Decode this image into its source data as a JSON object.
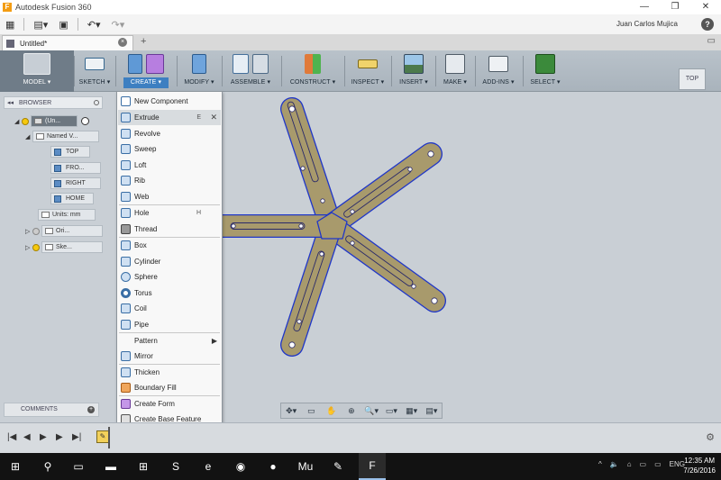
{
  "window": {
    "app_title": "Autodesk Fusion 360",
    "logo_letter": "F",
    "min_icon": "—",
    "close_icon": "✕",
    "restore_icon": "❐"
  },
  "quick_access": {
    "user": "Juan Carlos Mujica",
    "help": "?"
  },
  "document_tab": {
    "title": "Untitled*",
    "close": "×"
  },
  "ribbon": {
    "groups": [
      {
        "label": "MODEL ▾"
      },
      {
        "label": "SKETCH ▾"
      },
      {
        "label": "CREATE ▾"
      },
      {
        "label": "MODIFY ▾"
      },
      {
        "label": "ASSEMBLE ▾"
      },
      {
        "label": "CONSTRUCT ▾"
      },
      {
        "label": "INSPECT ▾"
      },
      {
        "label": "INSERT ▾"
      },
      {
        "label": "MAKE ▾"
      },
      {
        "label": "ADD-INS ▾"
      },
      {
        "label": "SELECT ▾"
      }
    ]
  },
  "viewcube": {
    "label": "TOP"
  },
  "browser": {
    "title": "BROWSER",
    "root": "(Un...",
    "named_views": "Named V...",
    "views": [
      "TOP",
      "FRO...",
      "RIGHT",
      "HOME"
    ],
    "units": "Units: mm",
    "origin": "Ori...",
    "sketches": "Ske..."
  },
  "comments": {
    "title": "COMMENTS",
    "plus": "+"
  },
  "create_menu": {
    "items": [
      {
        "label": "New Component",
        "shortcut": ""
      },
      {
        "label": "Extrude",
        "shortcut": "E"
      },
      {
        "label": "Revolve",
        "shortcut": ""
      },
      {
        "label": "Sweep",
        "shortcut": ""
      },
      {
        "label": "Loft",
        "shortcut": ""
      },
      {
        "label": "Rib",
        "shortcut": ""
      },
      {
        "label": "Web",
        "shortcut": ""
      },
      {
        "label": "Hole",
        "shortcut": "H"
      },
      {
        "label": "Thread",
        "shortcut": ""
      },
      {
        "label": "Box",
        "shortcut": ""
      },
      {
        "label": "Cylinder",
        "shortcut": ""
      },
      {
        "label": "Sphere",
        "shortcut": ""
      },
      {
        "label": "Torus",
        "shortcut": ""
      },
      {
        "label": "Coil",
        "shortcut": ""
      },
      {
        "label": "Pipe",
        "shortcut": ""
      },
      {
        "label": "Pattern",
        "shortcut": ""
      },
      {
        "label": "Mirror",
        "shortcut": ""
      },
      {
        "label": "Thicken",
        "shortcut": ""
      },
      {
        "label": "Boundary Fill",
        "shortcut": ""
      },
      {
        "label": "Create Form",
        "shortcut": ""
      },
      {
        "label": "Create Base Feature",
        "shortcut": ""
      }
    ],
    "highlighted": "Extrude",
    "submenu_arrow": "▶",
    "close_x": "✕"
  },
  "nav_toolbar": {
    "icons": [
      "✥▾",
      "▭",
      "✋",
      "⊕",
      "🔍▾",
      "▭▾",
      "▦▾",
      "▤▾"
    ]
  },
  "timeline": {
    "first": "|◀",
    "prev": "◀",
    "play": "▶",
    "next": "▶",
    "last": "▶|",
    "gear": "⚙"
  },
  "taskbar": {
    "time": "12:35 AM",
    "date": "7/26/2016",
    "lang": "ENG",
    "tray": [
      "^",
      "🔈",
      "⌂",
      "▭",
      "▭"
    ]
  },
  "colors": {
    "canvas": "#c9cfd5",
    "part_fill": "#a89a6c",
    "part_edge": "#1f36c8",
    "accent": "#3d7fc1"
  }
}
